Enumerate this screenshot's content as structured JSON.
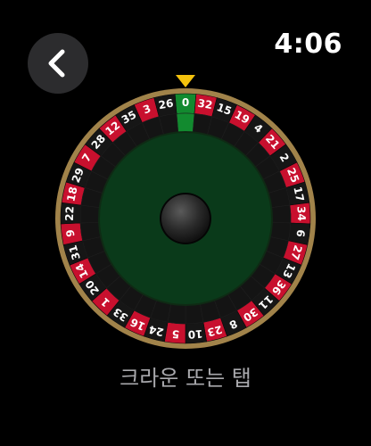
{
  "header": {
    "back_icon": "chevron-left-icon",
    "time": "4:06"
  },
  "wheel": {
    "pointer_icon": "triangle-down-icon",
    "numbers": [
      0,
      32,
      15,
      19,
      4,
      21,
      2,
      25,
      17,
      34,
      6,
      27,
      13,
      36,
      11,
      30,
      8,
      23,
      10,
      5,
      24,
      16,
      33,
      1,
      20,
      14,
      31,
      9,
      22,
      18,
      29,
      7,
      28,
      12,
      35,
      3,
      26
    ],
    "colors": {
      "red": "#c8102e",
      "black": "#161616",
      "green": "#128a2f",
      "rim": "#a1834a",
      "felt": "#0a3a1a",
      "pointer": "#f4c20d"
    }
  },
  "hint_text": "크라운 또는 탭"
}
